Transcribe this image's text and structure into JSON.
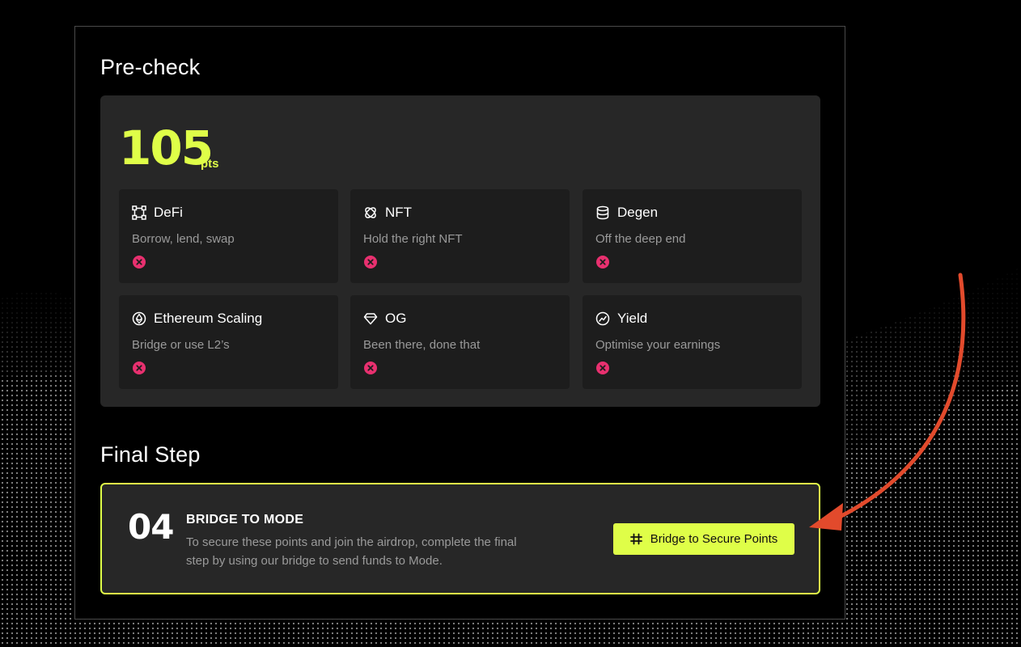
{
  "precheck": {
    "title": "Pre-check",
    "score": "105",
    "score_unit": "pts",
    "tiles": [
      {
        "icon": "defi-icon",
        "title": "DeFi",
        "desc": "Borrow, lend, swap",
        "status": "not-eligible"
      },
      {
        "icon": "nft-icon",
        "title": "NFT",
        "desc": "Hold the right NFT",
        "status": "not-eligible"
      },
      {
        "icon": "database-icon",
        "title": "Degen",
        "desc": "Off the deep end",
        "status": "not-eligible"
      },
      {
        "icon": "ethereum-icon",
        "title": "Ethereum Scaling",
        "desc": "Bridge or use L2’s",
        "status": "not-eligible"
      },
      {
        "icon": "diamond-icon",
        "title": "OG",
        "desc": "Been there, done that",
        "status": "not-eligible"
      },
      {
        "icon": "chart-icon",
        "title": "Yield",
        "desc": "Optimise your earnings",
        "status": "not-eligible"
      }
    ]
  },
  "final": {
    "title": "Final Step",
    "step_number": "04",
    "step_title": "BRIDGE TO MODE",
    "step_desc": "To secure these points and join the airdrop, complete the final step by using our bridge to send funds to Mode.",
    "button_label": "Bridge to Secure Points",
    "button_icon": "bridge-icon"
  },
  "colors": {
    "accent": "#dffe48",
    "status_x": "#e8306f",
    "annotation_arrow": "#e24a2c"
  }
}
